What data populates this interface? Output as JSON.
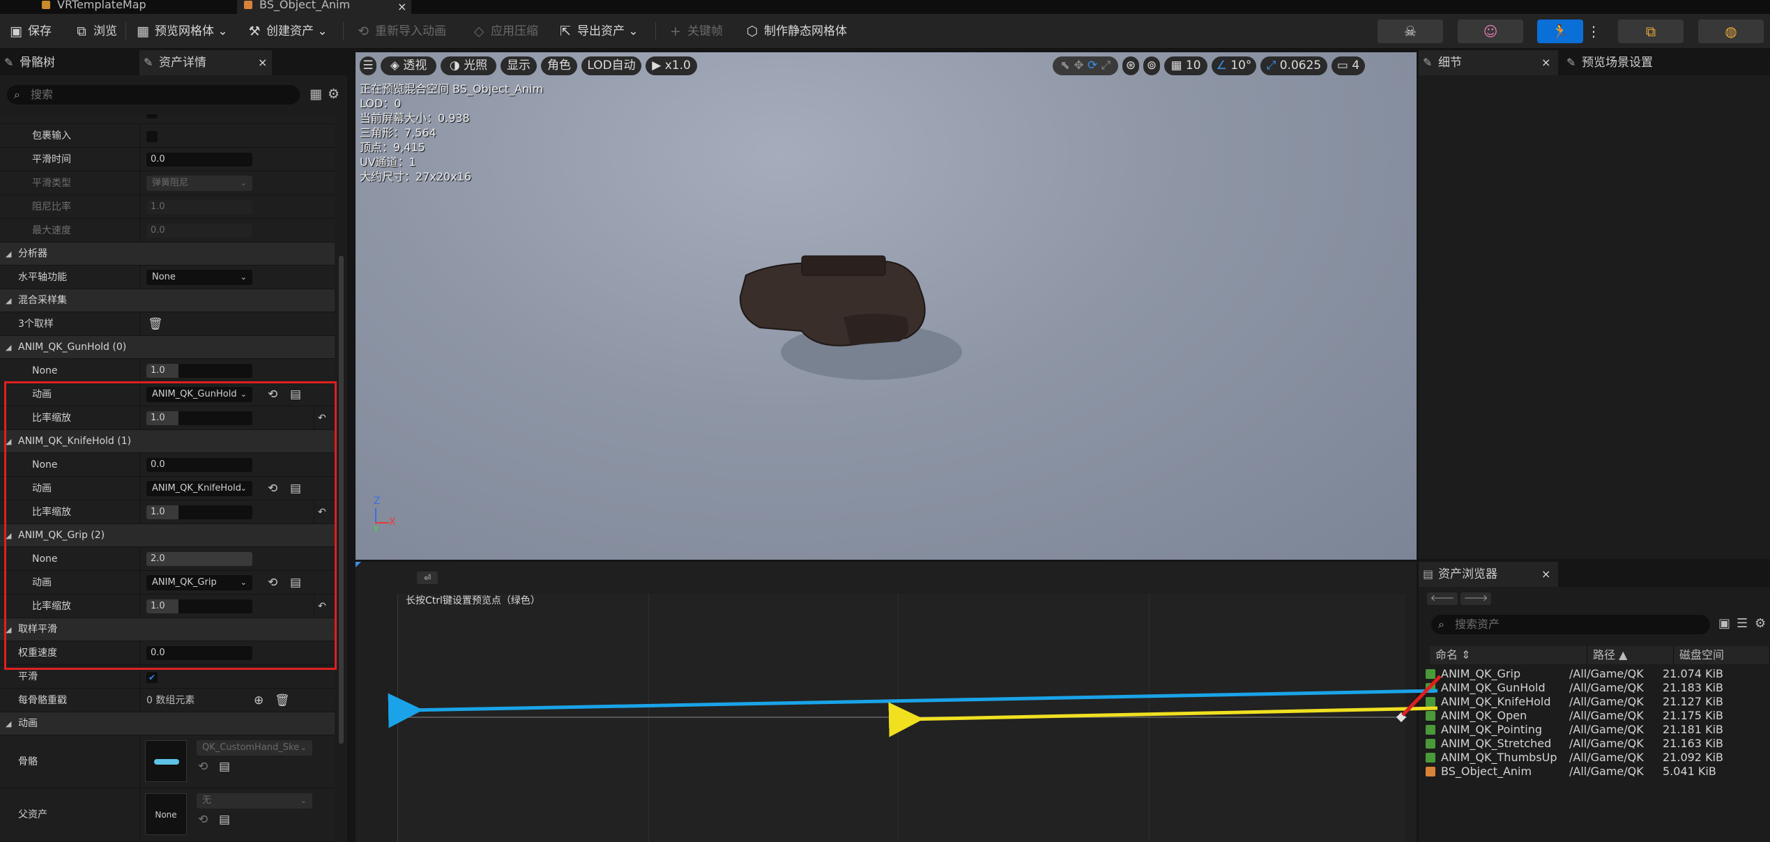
{
  "tabs": [
    {
      "label": "VRTemplateMap"
    },
    {
      "label": "BS_Object_Anim"
    }
  ],
  "toolbar": {
    "save": "保存",
    "browse": "浏览",
    "preview_mesh": "预览网格体",
    "create_asset": "创建资产",
    "reimport": "重新导入动画",
    "apply_compression": "应用压缩",
    "export_asset": "导出资产",
    "keyframe": "关键帧",
    "make_static_mesh": "制作静态网格体"
  },
  "left_panel": {
    "tab_skeleton": "骨骼树",
    "tab_asset_details": "资产详情",
    "search_placeholder": "搜索",
    "rows": {
      "include_input": "包裹输入",
      "smoothing_time": "平滑时间",
      "smoothing_time_value": "0.0",
      "smoothing_type": "平滑类型",
      "smoothing_type_value": "弹簧阻尼",
      "damping_ratio": "阻尼比率",
      "damping_ratio_value": "1.0",
      "max_speed": "最大速度",
      "max_speed_value": "0.0",
      "analysis": "分析器",
      "horizontal_axis_func": "水平轴功能",
      "horizontal_axis_value": "None",
      "blend_samples": "混合采样集",
      "sample_count": "3个取样"
    },
    "samples": [
      {
        "header": "ANIM_QK_GunHold (0)",
        "none_label": "None",
        "none_value": "1.0",
        "none_fill": 0.3,
        "anim_label": "动画",
        "anim_value": "ANIM_QK_GunHold",
        "rate_label": "比率缩放",
        "rate_value": "1.0",
        "rate_fill": 0.3
      },
      {
        "header": "ANIM_QK_KnifeHold (1)",
        "none_label": "None",
        "none_value": "0.0",
        "none_fill": 0,
        "anim_label": "动画",
        "anim_value": "ANIM_QK_KnifeHold",
        "rate_label": "比率缩放",
        "rate_value": "1.0",
        "rate_fill": 0.3
      },
      {
        "header": "ANIM_QK_Grip (2)",
        "none_label": "None",
        "none_value": "2.0",
        "none_fill": 1,
        "anim_label": "动画",
        "anim_value": "ANIM_QK_Grip",
        "rate_label": "比率缩放",
        "rate_value": "1.0",
        "rate_fill": 0.3
      }
    ],
    "sample_smoothing": "取样平滑",
    "weight_speed": "权重速度",
    "weight_speed_value": "0.0",
    "smooth": "平滑",
    "per_bone": "每骨骼重戳",
    "per_bone_value": "0 数组元素",
    "animation": "动画",
    "skeleton": "骨骼",
    "skeleton_value": "QK_CustomHand_Ske",
    "parent_asset": "父资产",
    "parent_value": "无",
    "parent_thumb": "None"
  },
  "viewport": {
    "buttons": {
      "perspective": "透视",
      "lighting": "光照",
      "show": "显示",
      "character": "角色",
      "lod": "LOD自动",
      "play": "x1.0"
    },
    "grid_snap": "10",
    "angle_snap": "10°",
    "scale_snap": "0.0625",
    "camera_speed": "4",
    "overlay": [
      "正在预览混合空间 BS_Object_Anim",
      "LOD：0",
      "当前屏幕大小：0.938",
      "三角形：7,564",
      "顶点：9,415",
      "UV通道：1",
      "大约尺寸：27x20x16"
    ]
  },
  "timeline": {
    "hint": "长按Ctrl键设置预览点（绿色）"
  },
  "right_panel": {
    "details": "细节",
    "preview_scene": "预览场景设置"
  },
  "asset_browser": {
    "title": "资产浏览器",
    "search_placeholder": "搜索资产",
    "columns": {
      "name": "命名",
      "path": "路径",
      "size": "磁盘空间"
    },
    "assets": [
      {
        "name": "ANIM_QK_Grip",
        "path": "/All/Game/QK",
        "size": "21.074 KiB",
        "color": "#4a9a3a"
      },
      {
        "name": "ANIM_QK_GunHold",
        "path": "/All/Game/QK",
        "size": "21.183 KiB",
        "color": "#4a9a3a"
      },
      {
        "name": "ANIM_QK_KnifeHold",
        "path": "/All/Game/QK",
        "size": "21.127 KiB",
        "color": "#4a9a3a"
      },
      {
        "name": "ANIM_QK_Open",
        "path": "/All/Game/QK",
        "size": "21.175 KiB",
        "color": "#4a9a3a"
      },
      {
        "name": "ANIM_QK_Pointing",
        "path": "/All/Game/QK",
        "size": "21.181 KiB",
        "color": "#4a9a3a"
      },
      {
        "name": "ANIM_QK_Stretched",
        "path": "/All/Game/QK",
        "size": "21.163 KiB",
        "color": "#4a9a3a"
      },
      {
        "name": "ANIM_QK_ThumbsUp",
        "path": "/All/Game/QK",
        "size": "21.092 KiB",
        "color": "#4a9a3a"
      },
      {
        "name": "BS_Object_Anim",
        "path": "/All/Game/QK",
        "size": "5.041 KiB",
        "color": "#d9823a"
      }
    ]
  },
  "annotation_colors": {
    "highlight": "#e02020",
    "arrow_gunhold": "#1aa3e8",
    "arrow_knifehold": "#f0e020"
  }
}
